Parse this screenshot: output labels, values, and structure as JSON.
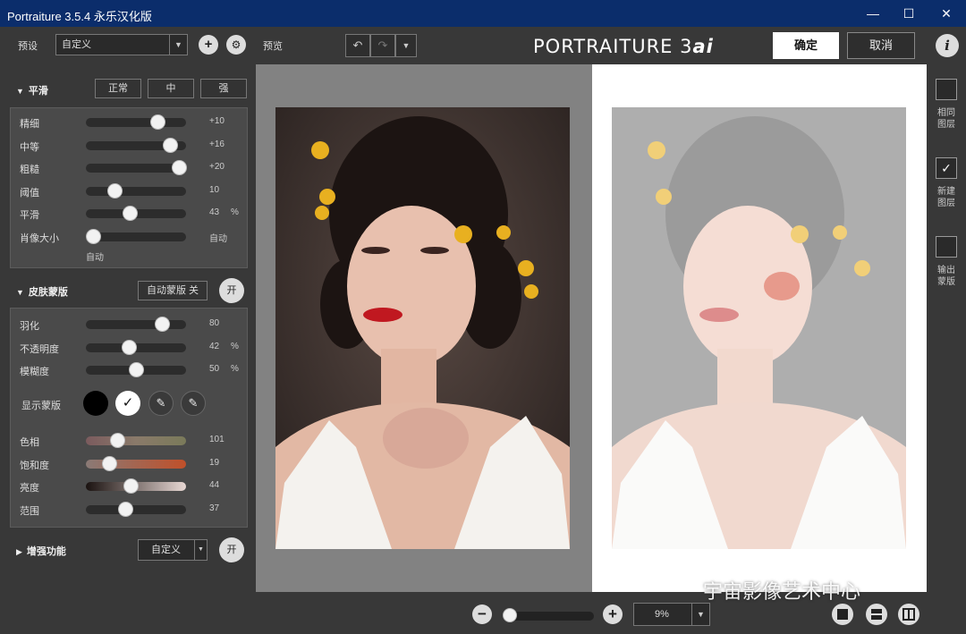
{
  "window": {
    "title": "Portraiture 3.5.4 永乐汉化版",
    "minimize": "—",
    "maximize": "☐",
    "close": "✕"
  },
  "toolbar": {
    "preset_label": "预设",
    "preset_value": "自定义",
    "preview_label": "预览",
    "logo_main": "PORTRAITURE 3",
    "logo_ai": "ai",
    "ok_label": "确定",
    "cancel_label": "取消",
    "info_label": "i"
  },
  "smoothing": {
    "title": "平滑",
    "presets": [
      "正常",
      "中",
      "强"
    ],
    "rows": [
      {
        "label": "精细",
        "value": 10,
        "display": "+10",
        "min": -20,
        "max": 20,
        "unit": ""
      },
      {
        "label": "中等",
        "value": 16,
        "display": "+16",
        "min": -20,
        "max": 20,
        "unit": ""
      },
      {
        "label": "粗糙",
        "value": 20,
        "display": "+20",
        "min": -20,
        "max": 20,
        "unit": ""
      },
      {
        "label": "阈值",
        "value": 10,
        "display": "10",
        "min": 0,
        "max": 40,
        "unit": ""
      },
      {
        "label": "平滑",
        "value": 43,
        "display": "43",
        "min": 0,
        "max": 100,
        "unit": "%"
      },
      {
        "label": "肖像大小",
        "value": 0,
        "display": "自动",
        "min": 0,
        "max": 100,
        "unit": ""
      }
    ],
    "auto_label": "自动"
  },
  "skin_mask": {
    "title": "皮肤蒙版",
    "auto_mask_label": "自动蒙版 关",
    "toggle_label": "开",
    "rows": [
      {
        "label": "羽化",
        "value": 80,
        "display": "80",
        "min": 0,
        "max": 100,
        "unit": ""
      },
      {
        "label": "不透明度",
        "value": 42,
        "display": "42",
        "min": 0,
        "max": 100,
        "unit": "%"
      },
      {
        "label": "模糊度",
        "value": 50,
        "display": "50",
        "min": 0,
        "max": 100,
        "unit": "%"
      }
    ],
    "show_mask_label": "显示蒙版",
    "check_mark": "✓",
    "color_rows": [
      {
        "label": "色相",
        "value": 101,
        "display": "101",
        "min": 0,
        "max": 360,
        "gradient": "linear-gradient(90deg,#7b5b5e,#8a7a6a,#7a7a5a)"
      },
      {
        "label": "饱和度",
        "value": 19,
        "display": "19",
        "min": 0,
        "max": 100,
        "gradient": "linear-gradient(90deg,#8a7a76,#c0502a)"
      },
      {
        "label": "亮度",
        "value": 44,
        "display": "44",
        "min": 0,
        "max": 100,
        "gradient": "linear-gradient(90deg,#1a1210,#e8d8d4)"
      },
      {
        "label": "范围",
        "value": 37,
        "display": "37",
        "min": 0,
        "max": 100,
        "gradient": ""
      }
    ]
  },
  "enhance": {
    "title": "增强功能",
    "select_value": "自定义",
    "toggle_label": "开"
  },
  "right_panel": [
    {
      "label": "相同\n图层",
      "checked": false
    },
    {
      "label": "新建\n图层",
      "checked": true
    },
    {
      "label": "输出\n蒙版",
      "checked": false
    }
  ],
  "bottom": {
    "zoom_out": "−",
    "zoom_in": "+",
    "zoom_value": "9%",
    "zoom_fraction": 0.0
  },
  "watermark": "宇宙影像艺术中心",
  "colors": {
    "title_bar": "#0b2d6b",
    "panel_bg": "#383838",
    "group_bg": "#4a4a4a"
  }
}
